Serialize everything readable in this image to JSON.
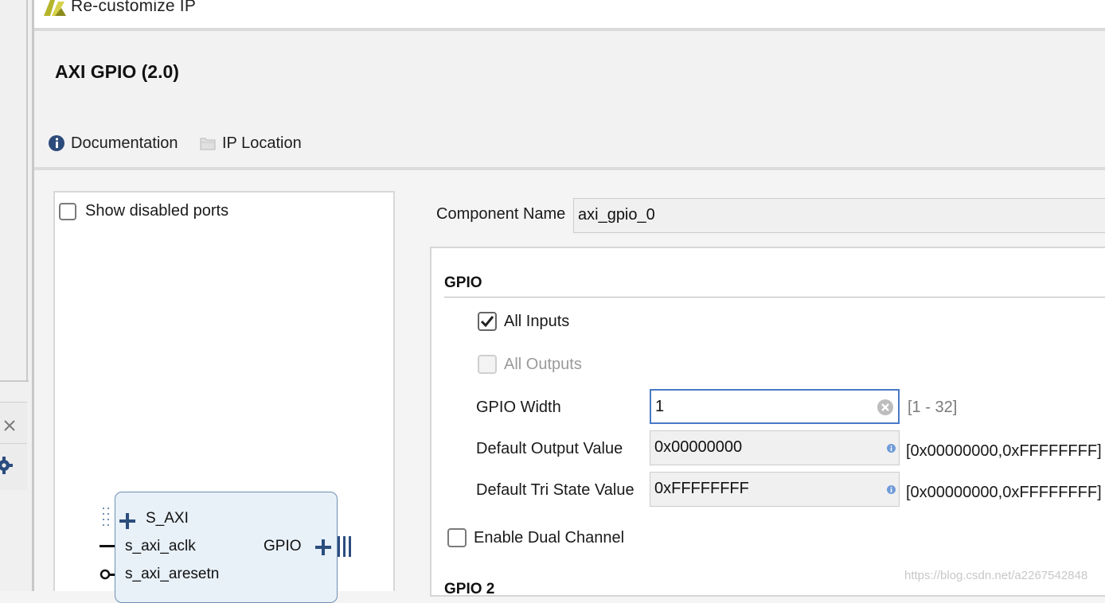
{
  "window": {
    "title": "Re-customize IP",
    "logo_icon": "vivado-logo-icon"
  },
  "header": {
    "ip_name": "AXI GPIO (2.0)",
    "links": [
      {
        "label": "Documentation",
        "icon": "info-icon"
      },
      {
        "label": "IP Location",
        "icon": "folder-icon"
      }
    ]
  },
  "symbol_panel": {
    "show_disabled_ports_label": "Show disabled ports",
    "show_disabled_ports_checked": false,
    "block": {
      "ports_left": [
        "S_AXI",
        "s_axi_aclk",
        "s_axi_aresetn"
      ],
      "ports_right": [
        "GPIO"
      ]
    }
  },
  "config": {
    "component_name_label": "Component Name",
    "component_name_value": "axi_gpio_0",
    "section1_title": "GPIO",
    "all_inputs": {
      "label": "All Inputs",
      "checked": true
    },
    "all_outputs": {
      "label": "All Outputs",
      "checked": false,
      "disabled": true
    },
    "gpio_width": {
      "label": "GPIO Width",
      "value": "1",
      "range": "[1 - 32]"
    },
    "default_output": {
      "label": "Default Output Value",
      "value": "0x00000000",
      "range": "[0x00000000,0xFFFFFFFF]"
    },
    "default_tristate": {
      "label": "Default Tri State Value",
      "value": "0xFFFFFFFF",
      "range": "[0x00000000,0xFFFFFFFF]"
    },
    "enable_dual": {
      "label": "Enable Dual Channel",
      "checked": false
    },
    "section2_title": "GPIO 2"
  },
  "watermark": "https://blog.csdn.net/a2267542848",
  "colors": {
    "focus_border": "#4a79c8",
    "block_fill": "#e8f0f8",
    "block_border": "#6f8fb3",
    "port_blue": "#2b4d7e",
    "range_gray": "#7a7a7a"
  }
}
